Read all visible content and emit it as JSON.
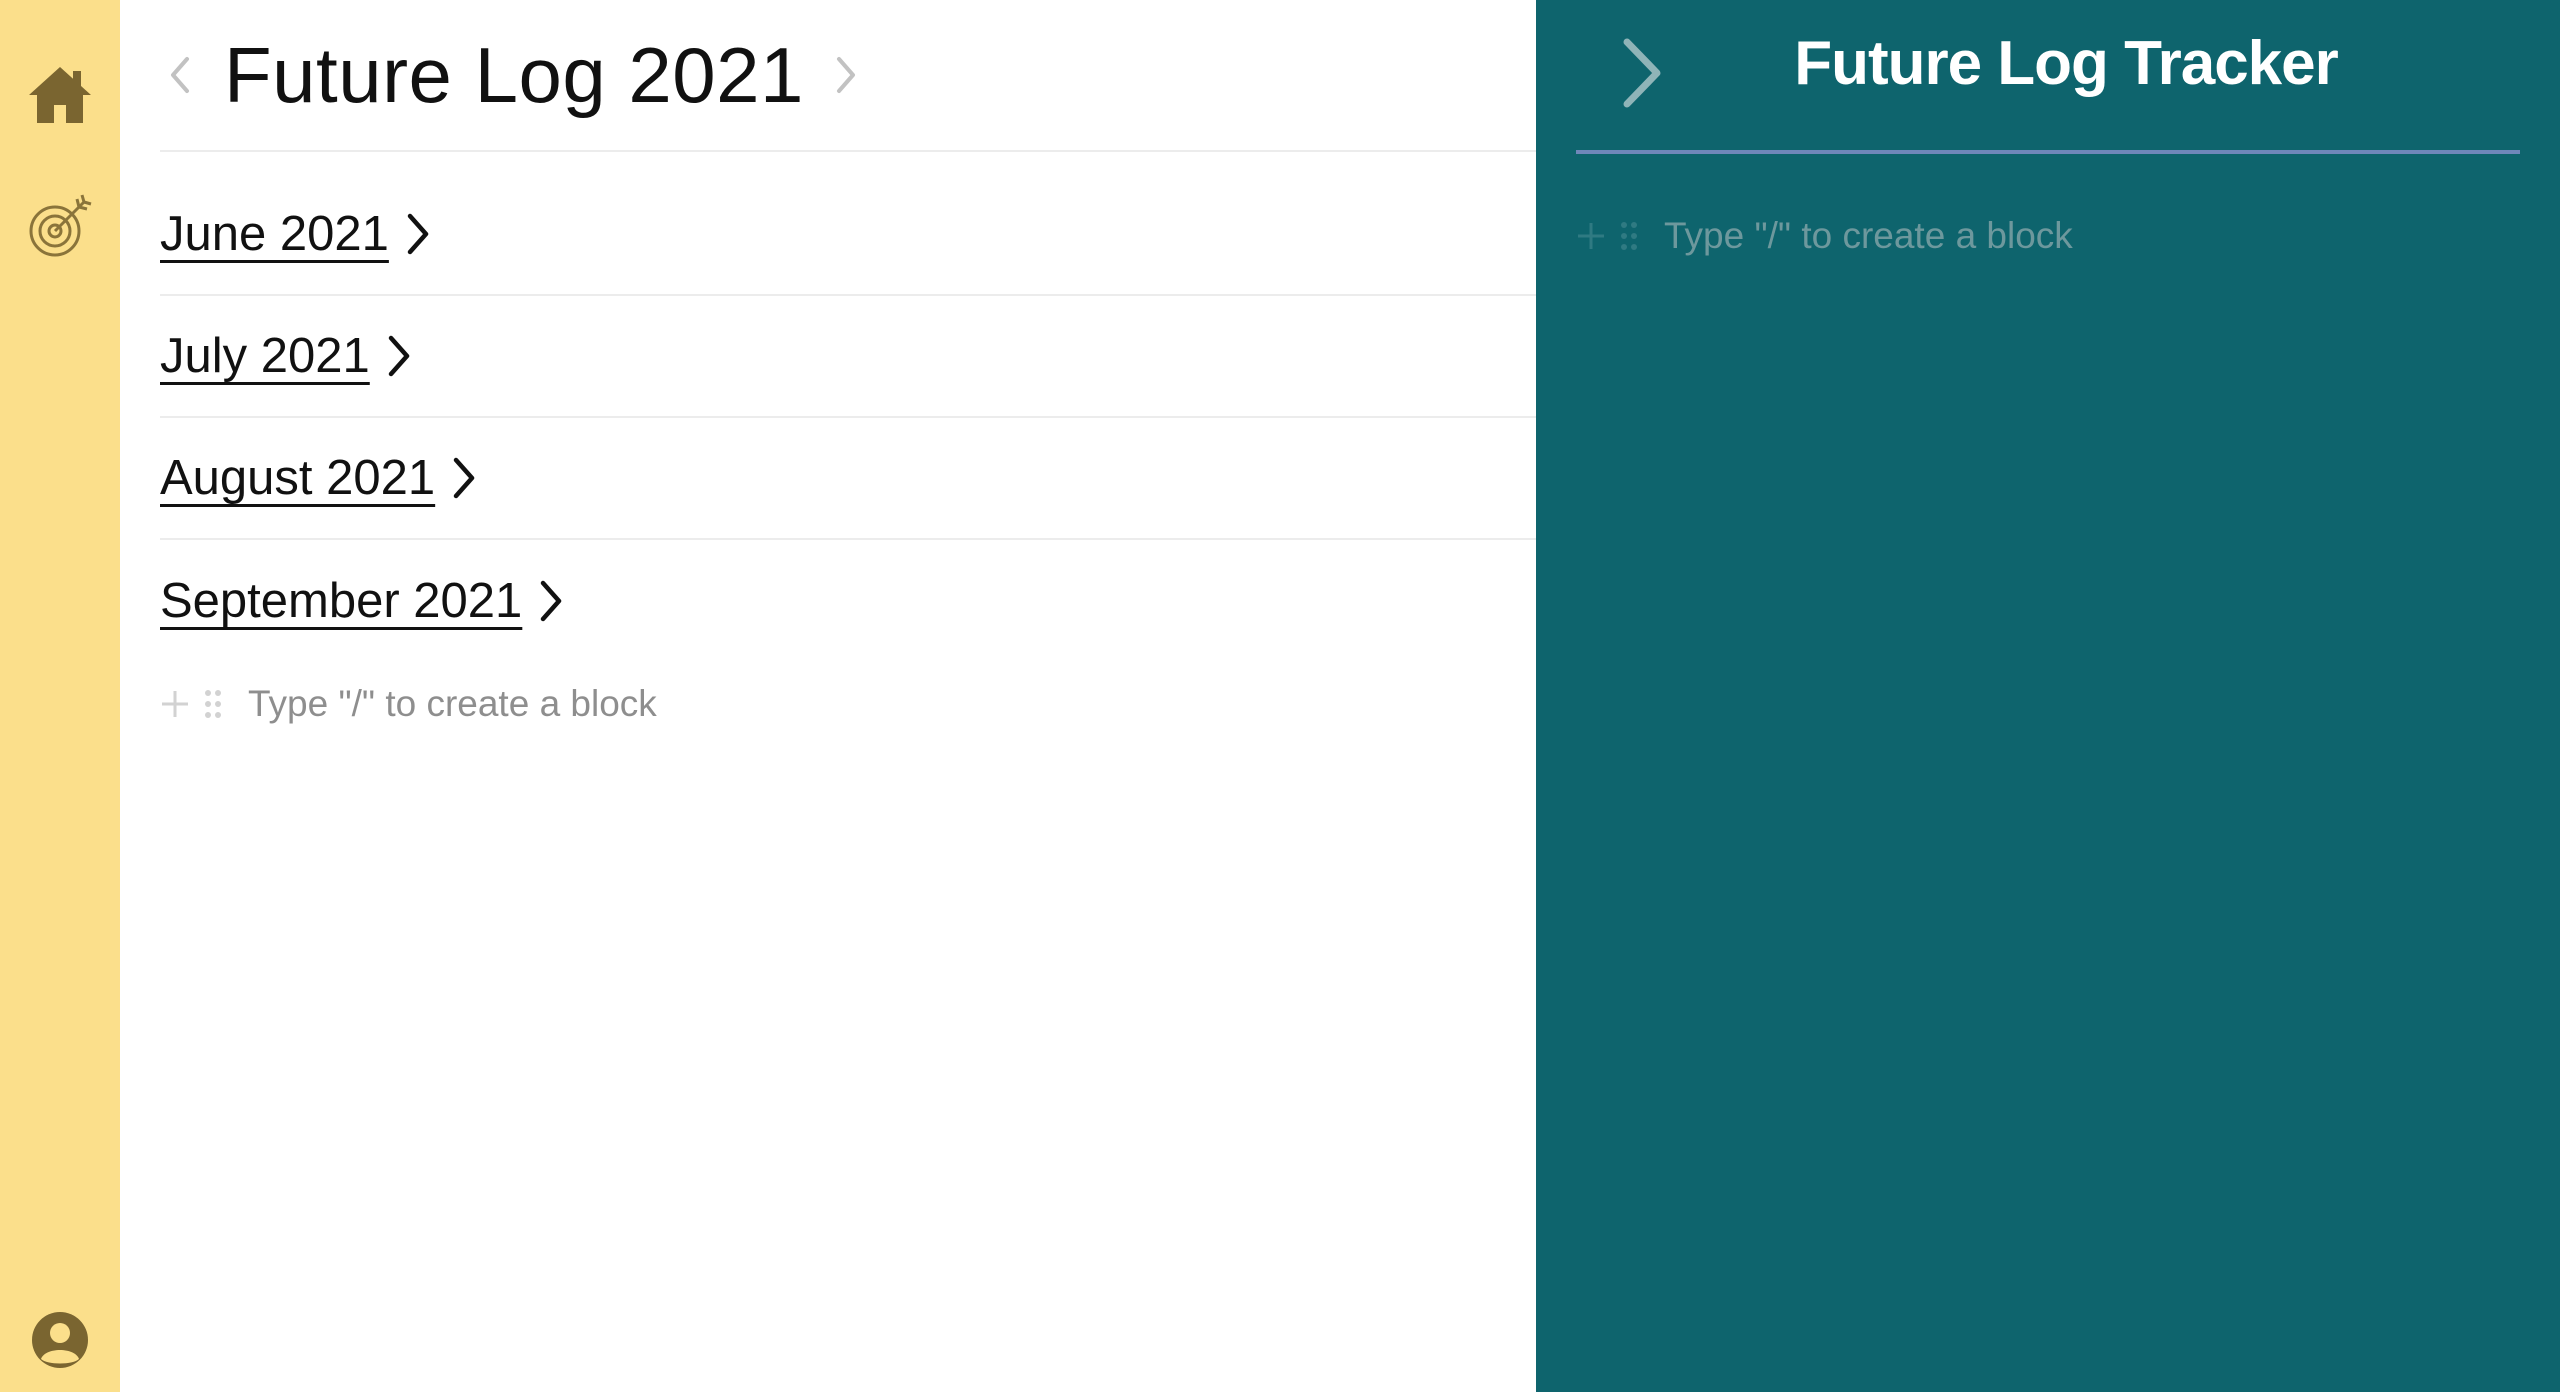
{
  "sidebar": {
    "icons": [
      "home-icon",
      "target-icon",
      "user-profile-icon"
    ],
    "color": "#fbdf8b",
    "icon_color": "#7a6530"
  },
  "main": {
    "title": "Future Log 2021",
    "months": [
      {
        "label": "June 2021"
      },
      {
        "label": "July 2021"
      },
      {
        "label": "August 2021"
      },
      {
        "label": "September 2021"
      }
    ],
    "block_placeholder": "Type \"/\" to create a block"
  },
  "tracker": {
    "title": "Future Log Tracker",
    "block_placeholder": "Type \"/\" to create a block",
    "background": "#0e646d",
    "divider_color": "#6f87b9"
  }
}
